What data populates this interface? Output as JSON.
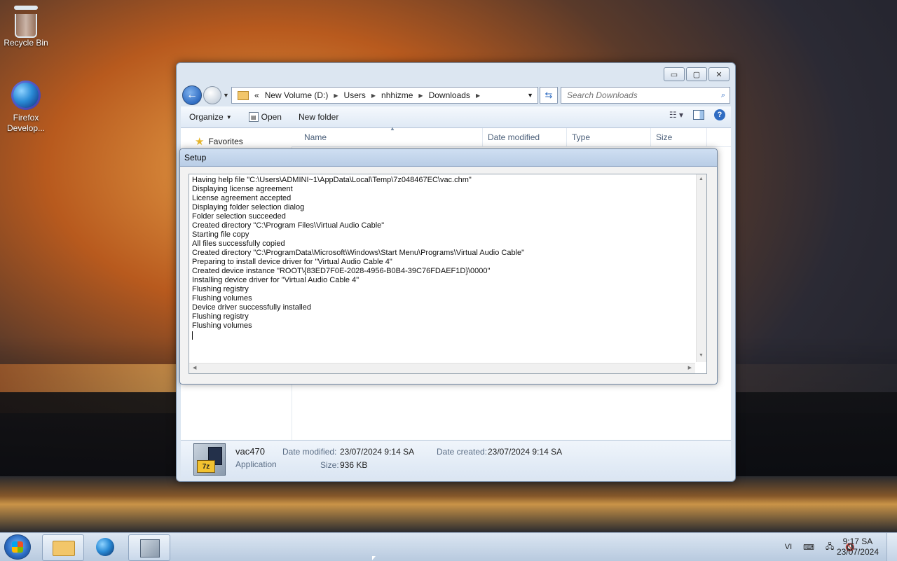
{
  "desktop": {
    "icons": [
      {
        "label": "Recycle Bin",
        "icon": "recycle-bin-icon"
      },
      {
        "label": "Firefox\nDevelop...",
        "icon": "firefox-icon"
      }
    ]
  },
  "explorer": {
    "window_buttons": {
      "minimize": "▭",
      "maximize": "▢",
      "close": "✕"
    },
    "breadcrumb": [
      "New Volume (D:)",
      "Users",
      "nhhizme",
      "Downloads"
    ],
    "breadcrumb_prefix": "«",
    "search_placeholder": "Search Downloads",
    "toolbar": {
      "organize": "Organize",
      "open": "Open",
      "new_folder": "New folder"
    },
    "nav": {
      "favorites": "Favorites"
    },
    "columns": [
      "Name",
      "Date modified",
      "Type",
      "Size"
    ],
    "details": {
      "name": "vac470",
      "kind": "Application",
      "date_modified_label": "Date modified:",
      "date_modified": "23/07/2024 9:14 SA",
      "date_created_label": "Date created:",
      "date_created": "23/07/2024 9:14 SA",
      "size_label": "Size:",
      "size": "936 KB",
      "icon_badge": "7z"
    }
  },
  "setup": {
    "title": "Setup",
    "log": [
      "Having help file \"C:\\Users\\ADMINI~1\\AppData\\Local\\Temp\\7z048467EC\\vac.chm\"",
      "Displaying license agreement",
      "License agreement accepted",
      "Displaying folder selection dialog",
      "Folder selection succeeded",
      "Created directory \"C:\\Program Files\\Virtual Audio Cable\"",
      "Starting file copy",
      "All files successfully copied",
      "Created directory \"C:\\ProgramData\\Microsoft\\Windows\\Start Menu\\Programs\\Virtual Audio Cable\"",
      "Preparing to install device driver for \"Virtual Audio Cable 4\"",
      "Created device instance \"ROOT\\{83ED7F0E-2028-4956-B0B4-39C76FDAEF1D}\\0000\"",
      "Installing device driver for \"Virtual Audio Cable 4\"",
      "Flushing registry",
      "Flushing volumes",
      "Device driver successfully installed",
      "Flushing registry",
      "Flushing volumes"
    ]
  },
  "taskbar": {
    "language": "VI",
    "time": "9:17 SA",
    "date": "23/07/2024"
  }
}
